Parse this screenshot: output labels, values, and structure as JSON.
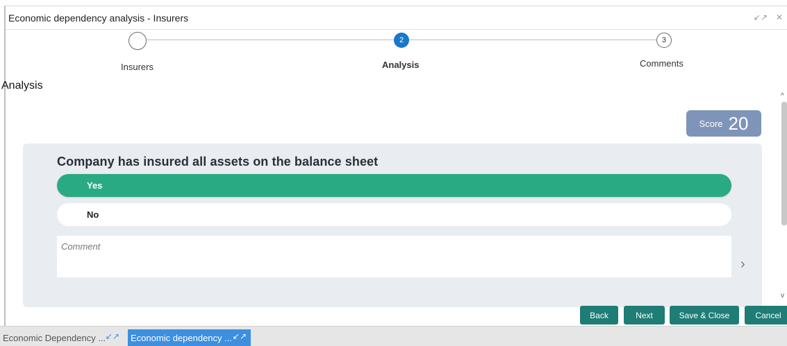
{
  "window": {
    "title": "Economic dependency analysis - Insurers",
    "minimize_icon": "↙↗",
    "close_icon": "✕"
  },
  "stepper": {
    "steps": [
      {
        "number": "",
        "label": "Insurers",
        "state": "done"
      },
      {
        "number": "2",
        "label": "Analysis",
        "state": "active"
      },
      {
        "number": "3",
        "label": "Comments",
        "state": "todo"
      }
    ]
  },
  "section_title": "Analysis",
  "score": {
    "label": "Score",
    "value": "20"
  },
  "question": {
    "text": "Company has insured all assets on the balance sheet",
    "options": [
      "Yes",
      "No"
    ],
    "selected": "Yes",
    "comment_placeholder": "Comment"
  },
  "footer": {
    "back": "Back",
    "next": "Next",
    "save_close": "Save & Close",
    "cancel": "Cancel"
  },
  "taskbar": {
    "items": [
      "Economic Dependency ...",
      "Economic dependency ..."
    ]
  },
  "colors": {
    "accent": "#1e7d75",
    "selected": "#2aaa82",
    "step_active": "#1a77c9",
    "score_bg": "#7e94b8"
  }
}
